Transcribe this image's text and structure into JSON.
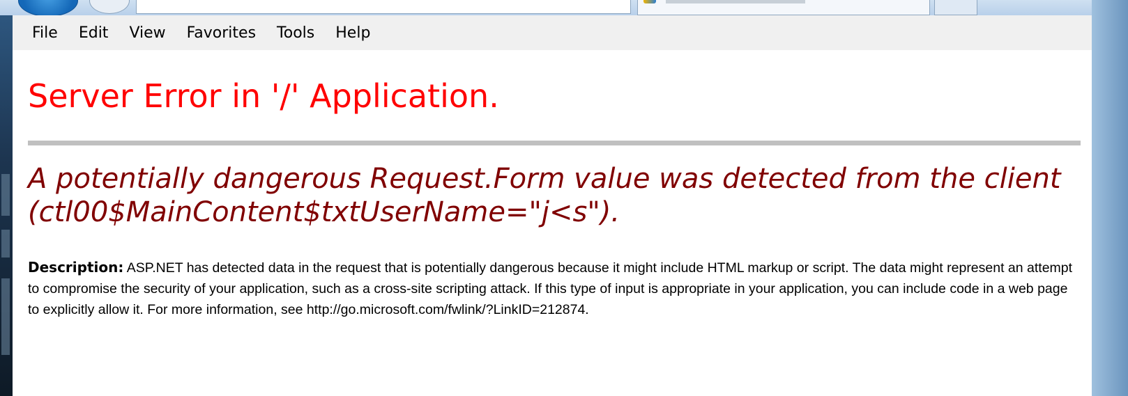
{
  "browser": {
    "menu": [
      "File",
      "Edit",
      "View",
      "Favorites",
      "Tools",
      "Help"
    ]
  },
  "page": {
    "title": "Server Error in '/' Application.",
    "error_heading": "A potentially dangerous Request.Form value was detected from the client (ctl00$MainContent$txtUserName=\"j<s\").",
    "description_label": "Description:",
    "description_text": "ASP.NET has detected data in the request that is potentially dangerous because it might include HTML markup or script. The data might represent an attempt to compromise the security of your application, such as a cross-site scripting attack. If this type of input is appropriate in your application, you can include code in a web page to explicitly allow it. For more information, see http://go.microsoft.com/fwlink/?LinkID=212874."
  },
  "colors": {
    "title": "#ff0000",
    "error_heading": "#800000",
    "rule": "#c0c0c0",
    "menubar_bg": "#f0f0f0"
  }
}
